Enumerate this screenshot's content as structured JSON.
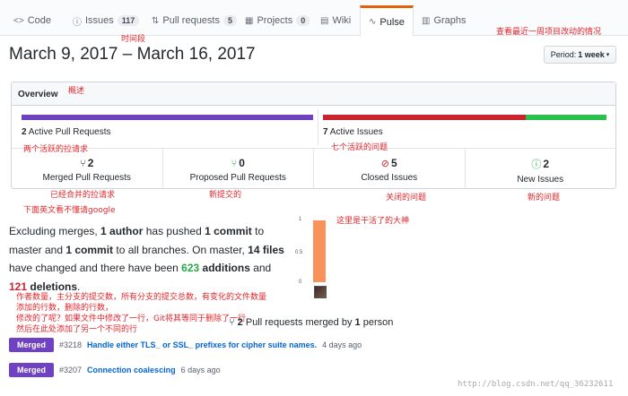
{
  "tabs": [
    {
      "label": "Code",
      "icon": "code-icon"
    },
    {
      "label": "Issues",
      "count": "117",
      "icon": "issue-icon"
    },
    {
      "label": "Pull requests",
      "count": "5",
      "icon": "pull-request-icon"
    },
    {
      "label": "Projects",
      "count": "0",
      "icon": "project-icon"
    },
    {
      "label": "Wiki",
      "icon": "book-icon"
    },
    {
      "label": "Pulse",
      "icon": "pulse-icon"
    },
    {
      "label": "Graphs",
      "icon": "graph-icon"
    }
  ],
  "date_range": "March 9, 2017 – March 16, 2017",
  "period": {
    "prefix": "Period:",
    "value": "1 week"
  },
  "overview": {
    "title": "Overview",
    "active_prs": {
      "count": "2",
      "label": "Active Pull Requests"
    },
    "active_issues": {
      "count": "7",
      "label": "Active Issues"
    },
    "stats": [
      {
        "value": "2",
        "label": "Merged Pull Requests",
        "icon": "merge-icon"
      },
      {
        "value": "0",
        "label": "Proposed Pull Requests",
        "icon": "pull-request-icon"
      },
      {
        "value": "5",
        "label": "Closed Issues",
        "icon": "issue-closed-icon"
      },
      {
        "value": "2",
        "label": "New Issues",
        "icon": "issue-opened-icon"
      }
    ]
  },
  "summary": {
    "p1": "Excluding merges, ",
    "authors": "1 author",
    "p2": " has pushed ",
    "commits_master": "1 commit",
    "p3": " to master and ",
    "commits_all": "1 commit",
    "p4": " to all branches. On master, ",
    "files": "14 files",
    "p5": " have changed and there have been ",
    "additions": "623",
    "p6": " additions",
    "p7": " and ",
    "deletions": "121",
    "p8": " deletions",
    "p9": "."
  },
  "chart_data": {
    "type": "bar",
    "categories": [
      "author-1"
    ],
    "values": [
      1
    ],
    "ylim": [
      0,
      1
    ],
    "ticks": [
      "1",
      "0.5",
      "0"
    ],
    "bar_color": "#f9915a"
  },
  "merged_by": {
    "count": "2",
    "text": " Pull requests merged by ",
    "persons": "1",
    "suffix": " person",
    "icon": "merge-icon"
  },
  "pull_requests": [
    {
      "badge": "Merged",
      "number": "#3218",
      "title": "Handle either TLS_ or SSL_ prefixes for cipher suite names.",
      "time": "4 days ago"
    },
    {
      "badge": "Merged",
      "number": "#3207",
      "title": "Connection coalescing",
      "time": "6 days ago"
    }
  ],
  "annotations": {
    "period": "时间段",
    "recent": "查看最近一周项目改动的情况",
    "overview": "概述",
    "active_prs": "两个活跃的拉请求",
    "active_issues": "七个活跃的问题",
    "merged": "已经合并的拉请求",
    "proposed": "新提交的",
    "closed": "关闭的问题",
    "new": "新的问题",
    "english": "下面英文看不懂请google",
    "god": "这里是干活了的大神",
    "note1": "作者数量，主分支的提交数，所有分支的提交总数，有变化的文件数量",
    "note2": "添加的行数，删除的行数，",
    "note3": "修改的了呢？如果文件中修改了一行，Git将其等同于删除了一行",
    "note4": "然后在此处添加了另一个不同的行"
  },
  "watermark": "http://blog.csdn.net/qq_36232611",
  "colors": {
    "purple": "#6f42c1",
    "red": "#cb2431",
    "green": "#2cbe4e",
    "orange": "#e36209",
    "link": "#0366d6"
  }
}
